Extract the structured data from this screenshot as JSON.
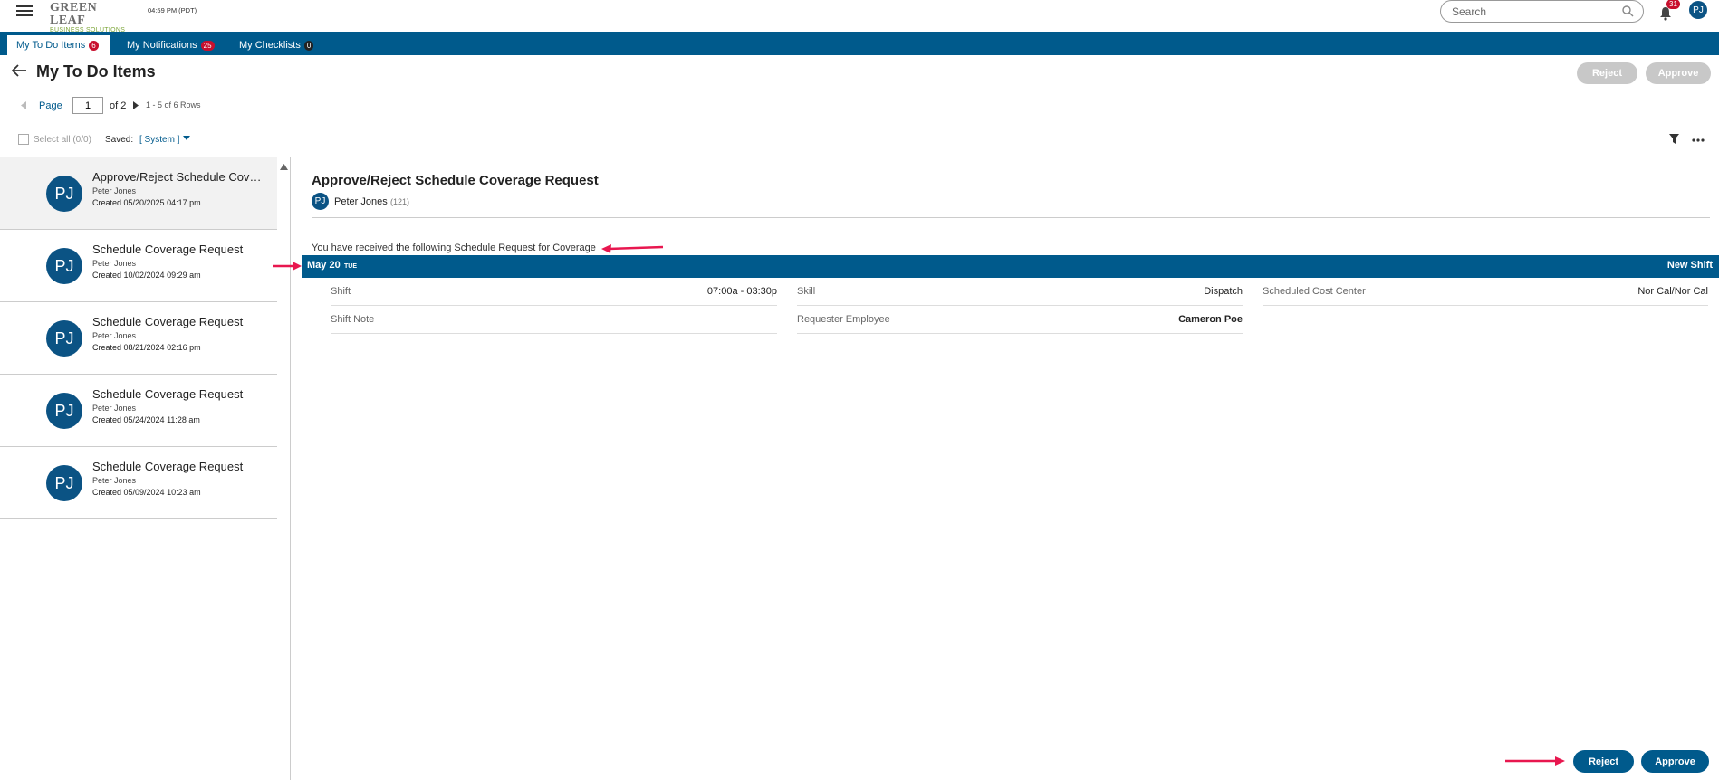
{
  "app": {
    "logo_line1": "GREEN LEAF",
    "logo_line2": "BUSINESS SOLUTIONS",
    "time": "04:59 PM (PDT)",
    "search_placeholder": "Search",
    "notifications_count": "31",
    "user_initials": "PJ"
  },
  "tabs": [
    {
      "label": "My To Do Items",
      "count": "6",
      "active": true
    },
    {
      "label": "My Notifications",
      "count": "25",
      "active": false
    },
    {
      "label": "My Checklists",
      "count": "0",
      "active": false
    }
  ],
  "header": {
    "title": "My To Do Items",
    "reject_label": "Reject",
    "approve_label": "Approve"
  },
  "pager": {
    "page_label": "Page",
    "page_value": "1",
    "of_label": "of 2",
    "rows_label": "1 - 5 of 6 Rows"
  },
  "filters": {
    "select_all_label": "Select all (0/0)",
    "saved_label": "Saved:",
    "saved_value": "[ System ]"
  },
  "items": [
    {
      "initials": "PJ",
      "title": "Approve/Reject Schedule Cover...",
      "name": "Peter Jones",
      "created": "Created 05/20/2025 04:17 pm",
      "selected": true
    },
    {
      "initials": "PJ",
      "title": "Schedule Coverage Request",
      "name": "Peter Jones",
      "created": "Created 10/02/2024 09:29 am",
      "selected": false
    },
    {
      "initials": "PJ",
      "title": "Schedule Coverage Request",
      "name": "Peter Jones",
      "created": "Created 08/21/2024 02:16 pm",
      "selected": false
    },
    {
      "initials": "PJ",
      "title": "Schedule Coverage Request",
      "name": "Peter Jones",
      "created": "Created 05/24/2024 11:28 am",
      "selected": false
    },
    {
      "initials": "PJ",
      "title": "Schedule Coverage Request",
      "name": "Peter Jones",
      "created": "Created 05/09/2024 10:23 am",
      "selected": false
    }
  ],
  "detail": {
    "title": "Approve/Reject Schedule Coverage Request",
    "requester_initials": "PJ",
    "requester_name": "Peter Jones",
    "requester_id": "(121)",
    "message": "You have received the following Schedule Request for Coverage",
    "day": "May 20",
    "weekday": "TUE",
    "shift_type": "New Shift",
    "fields": {
      "shift_key": "Shift",
      "shift_val": "07:00a - 03:30p",
      "skill_key": "Skill",
      "skill_val": "Dispatch",
      "cost_center_key": "Scheduled Cost Center",
      "cost_center_val": "Nor Cal/Nor Cal",
      "note_key": "Shift Note",
      "note_val": "",
      "requester_key": "Requester Employee",
      "requester_val": "Cameron Poe"
    },
    "reject_label": "Reject",
    "approve_label": "Approve"
  },
  "colors": {
    "brand": "#005a8c",
    "avatar": "#0b5384",
    "badge": "#c8102e",
    "annotation_arrow": "#e8174f"
  }
}
